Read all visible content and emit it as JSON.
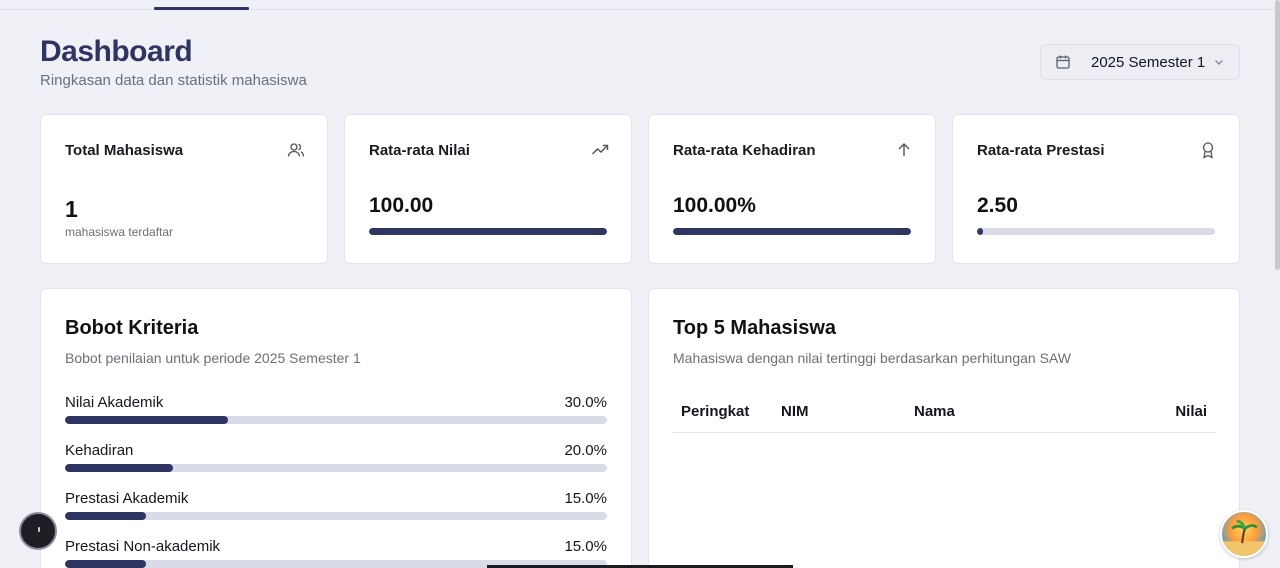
{
  "header": {
    "title": "Dashboard",
    "subtitle": "Ringkasan data dan statistik mahasiswa",
    "period": "2025 Semester 1",
    "period_icon": "calendar-icon"
  },
  "stats": [
    {
      "label": "Total Mahasiswa",
      "value": "1",
      "note": "mahasiswa terdaftar",
      "icon": "users-icon"
    },
    {
      "label": "Rata-rata Nilai",
      "value": "100.00",
      "progress": 1.0,
      "icon": "trending-up-icon"
    },
    {
      "label": "Rata-rata Kehadiran",
      "value": "100.00%",
      "progress": 1.0,
      "icon": "arrow-up-icon"
    },
    {
      "label": "Rata-rata Prestasi",
      "value": "2.50",
      "progress": 0.025,
      "icon": "award-icon"
    }
  ],
  "criteria": {
    "title": "Bobot Kriteria",
    "description": "Bobot penilaian untuk periode 2025 Semester 1",
    "items": [
      {
        "name": "Nilai Akademik",
        "weight": "30.0%",
        "fraction": 0.3
      },
      {
        "name": "Kehadiran",
        "weight": "20.0%",
        "fraction": 0.2
      },
      {
        "name": "Prestasi Akademik",
        "weight": "15.0%",
        "fraction": 0.15
      },
      {
        "name": "Prestasi Non-akademik",
        "weight": "15.0%",
        "fraction": 0.15
      }
    ]
  },
  "top5": {
    "title": "Top 5 Mahasiswa",
    "description": "Mahasiswa dengan nilai tertinggi berdasarkan perhitungan SAW",
    "columns": [
      "Peringkat",
      "NIM",
      "Nama",
      "Nilai"
    ],
    "rows": []
  },
  "colors": {
    "accent": "#2e3561",
    "track": "#d9dce6",
    "background": "#eff1f6"
  }
}
